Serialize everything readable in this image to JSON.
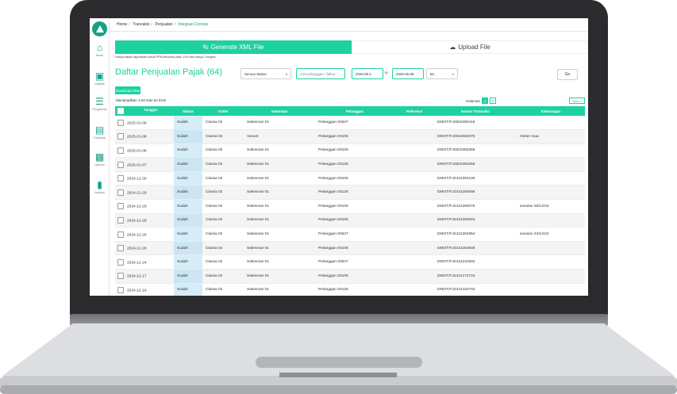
{
  "breadcrumb": [
    "Home",
    "Transaksi",
    "Penjualan",
    "Integrasi Coretax"
  ],
  "sidebar": [
    {
      "label": "Home",
      "icon": "home-icon"
    },
    {
      "label": "Statistik",
      "icon": "briefcase-icon"
    },
    {
      "label": "Pengaturan",
      "icon": "sliders-icon"
    },
    {
      "label": "Transaksi",
      "icon": "receipt-icon"
    },
    {
      "label": "Laporan",
      "icon": "clipboard-icon"
    },
    {
      "label": "Aplikasi",
      "icon": "device-icon"
    }
  ],
  "toolbar": {
    "generate_label": "Generate XML File",
    "upload_label": "Upload File",
    "note": "Hanya dapat digunakan untuk PPN keluaran yaitu 11% dan hanya 1 tingkat",
    "title": "Daftar Penjualan Pajak (64)",
    "status_select": "Semua Status",
    "search_placeholder": "Cari pelanggan / faktur",
    "date_from": "2025-05-1",
    "to_label": "to",
    "date_to": "2025-05-08",
    "per_page": "50",
    "go_label": "Go",
    "download_label": "Download XML",
    "showing": "Menampilkan 1-50 Dari 64 Entri",
    "halaman_label": "Halaman",
    "pages": [
      "1",
      "2"
    ],
    "next_label": "Next »"
  },
  "table": {
    "headers": [
      "Tanggal",
      "Status",
      "Outlet",
      "Salesman",
      "Pelanggan",
      "Referensi",
      "Nomor Transaksi",
      "Keterangan"
    ],
    "rows": [
      [
        "2025-01-09",
        "Sudah",
        "Classa 02",
        "Salesman 01",
        "Pelanggan 00547",
        "",
        "DMOT/FJ2501093419",
        ""
      ],
      [
        "2025-01-08",
        "Sudah",
        "Classa 02",
        "Vacant",
        "Pelanggan 00106",
        "",
        "DMOT/FJ2501083370",
        "mister maa"
      ],
      [
        "2025-01-08",
        "Sudah",
        "Classa 02",
        "Salesman 01",
        "Pelanggan 00106",
        "",
        "DMOT/FJ2501083369",
        ""
      ],
      [
        "2025-01-07",
        "Sudah",
        "Classa 02",
        "Salesman 01",
        "Pelanggan 00128",
        "",
        "DMOT/FJ2501063266",
        ""
      ],
      [
        "2024-12-30",
        "Sudah",
        "Classa 02",
        "Salesman 01",
        "Pelanggan 00106",
        "",
        "DMOT/FJ2412303130",
        ""
      ],
      [
        "2024-12-29",
        "Sudah",
        "Classa 02",
        "Salesman 01",
        "Pelanggan 00128",
        "",
        "DMOT/FJ2412293086",
        ""
      ],
      [
        "2024-12-29",
        "Sudah",
        "Classa 02",
        "Salesman 01",
        "Pelanggan 00106",
        "",
        "DMOT/FJ2412293076",
        "susulan 28/12/24"
      ],
      [
        "2024-12-28",
        "Sudah",
        "Classa 02",
        "Salesman 01",
        "Pelanggan 00106",
        "",
        "DMOT/FJ2412283023",
        ""
      ],
      [
        "2024-12-26",
        "Sudah",
        "Classa 02",
        "Salesman 01",
        "Pelanggan 00547",
        "",
        "DMOT/FJ2412262954",
        "susulan 24/12/24"
      ],
      [
        "2024-12-26",
        "Sudah",
        "Classa 02",
        "Salesman 01",
        "Pelanggan 00106",
        "",
        "DMOT/FJ2412262948",
        ""
      ],
      [
        "2024-12-24",
        "Sudah",
        "Classa 02",
        "Salesman 01",
        "Pelanggan 00547",
        "",
        "DMOT/FJ2412242902",
        ""
      ],
      [
        "2024-12-17",
        "Sudah",
        "Classa 02",
        "Salesman 01",
        "Pelanggan 00106",
        "",
        "DMOT/FJ2412172724",
        ""
      ],
      [
        "2024-12-16",
        "Sudah",
        "Classa 02",
        "Salesman 01",
        "Pelanggan 00128",
        "",
        "DMOT/FJ2412162702",
        ""
      ]
    ]
  },
  "colors": {
    "accent": "#1dd1a1",
    "status_bg": "#d6ecf7",
    "brand": "#16a085"
  }
}
